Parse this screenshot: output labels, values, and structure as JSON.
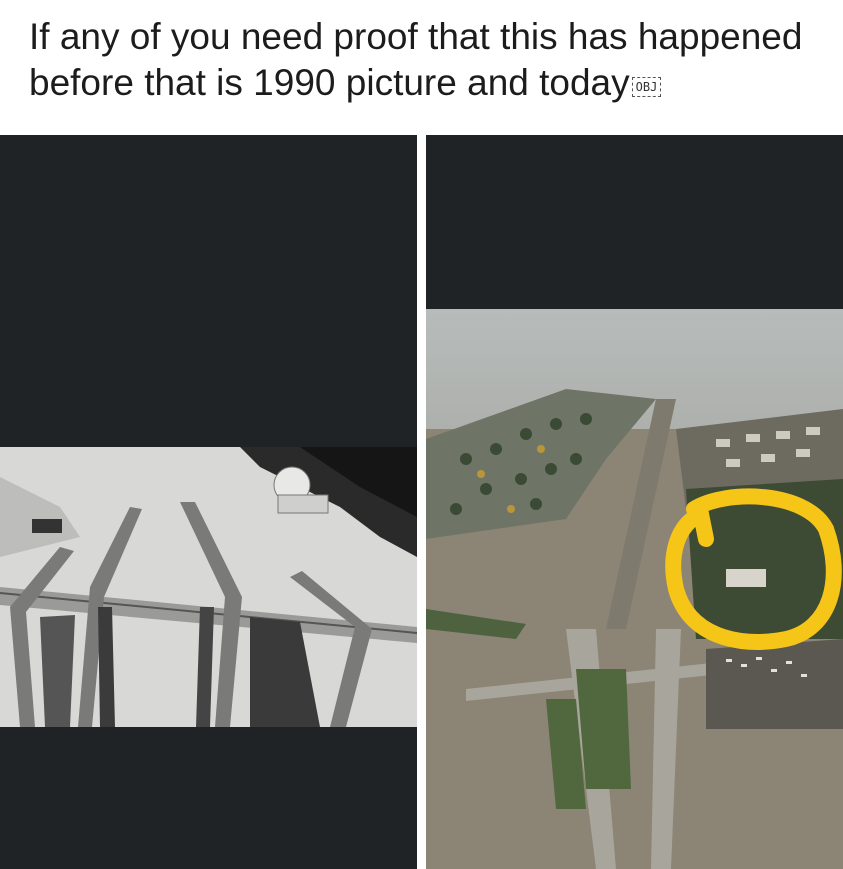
{
  "post": {
    "caption": "If any of you need proof that this has happened before that is 1990 picture and today",
    "caption_icon": "OBJ"
  },
  "images": {
    "left": {
      "description": "1990 black-and-white aerial photo of flooded highway interchange"
    },
    "right": {
      "description": "Recent color aerial photo of flooded highway interchange with a yellow circle highlighting a building"
    }
  },
  "colors": {
    "panel_background": "#202326",
    "highlight": "#f5c518",
    "flood_water": "#8c8474"
  }
}
